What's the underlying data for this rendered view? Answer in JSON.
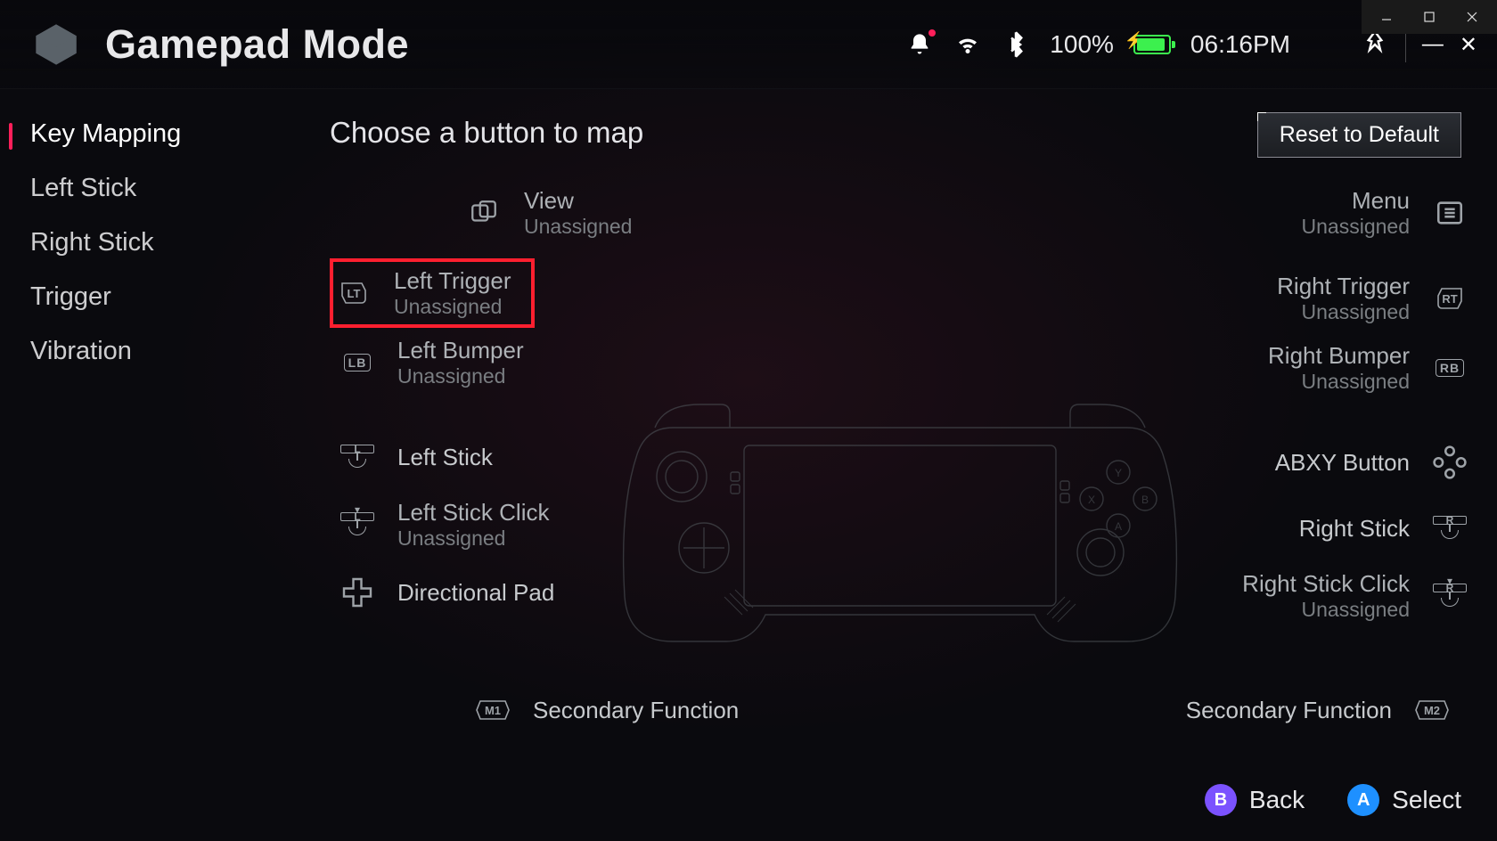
{
  "window_controls": {
    "minimize": "–",
    "maximize": "☐",
    "close": "×"
  },
  "header": {
    "title": "Gamepad Mode",
    "battery_percent": "100%",
    "time": "06:16PM"
  },
  "sidebar": {
    "items": [
      {
        "label": "Key Mapping",
        "active": true
      },
      {
        "label": "Left Stick",
        "active": false
      },
      {
        "label": "Right Stick",
        "active": false
      },
      {
        "label": "Trigger",
        "active": false
      },
      {
        "label": "Vibration",
        "active": false
      }
    ]
  },
  "main": {
    "heading": "Choose a button to map",
    "reset_label": "Reset to Default",
    "unassigned": "Unassigned"
  },
  "left_buttons": {
    "view": {
      "label": "View",
      "sub": "Unassigned",
      "badge": ""
    },
    "left_trigger": {
      "label": "Left Trigger",
      "sub": "Unassigned",
      "badge": "LT"
    },
    "left_bumper": {
      "label": "Left Bumper",
      "sub": "Unassigned",
      "badge": "LB"
    },
    "left_stick": {
      "label": "Left Stick",
      "badge": "L"
    },
    "left_click": {
      "label": "Left Stick Click",
      "sub": "Unassigned",
      "badge": "L"
    },
    "dpad": {
      "label": "Directional Pad"
    },
    "secondary": {
      "label": "Secondary Function",
      "badge": "M1"
    }
  },
  "right_buttons": {
    "menu": {
      "label": "Menu",
      "sub": "Unassigned"
    },
    "right_trigger": {
      "label": "Right Trigger",
      "sub": "Unassigned",
      "badge": "RT"
    },
    "right_bumper": {
      "label": "Right Bumper",
      "sub": "Unassigned",
      "badge": "RB"
    },
    "abxy": {
      "label": "ABXY Button"
    },
    "right_stick": {
      "label": "Right Stick",
      "badge": "R"
    },
    "right_click": {
      "label": "Right Stick Click",
      "sub": "Unassigned",
      "badge": "R"
    },
    "secondary": {
      "label": "Secondary Function",
      "badge": "M2"
    }
  },
  "footer": {
    "back": {
      "glyph": "B",
      "label": "Back"
    },
    "select": {
      "glyph": "A",
      "label": "Select"
    }
  }
}
